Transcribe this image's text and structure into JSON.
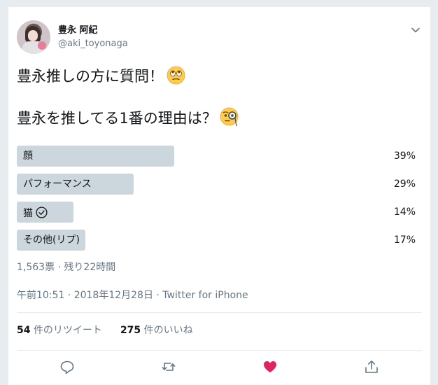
{
  "user": {
    "name": "豊永 阿紀",
    "handle": "@aki_toyonaga"
  },
  "tweet": {
    "line1": "豊永推しの方に質問！",
    "line2": "豊永を推してる1番の理由は？"
  },
  "poll": {
    "options": [
      {
        "label": "顔",
        "percent": 39,
        "percent_label": "39%"
      },
      {
        "label": "パフォーマンス",
        "percent": 29,
        "percent_label": "29%"
      },
      {
        "label": "猫",
        "percent": 14,
        "percent_label": "14%",
        "selected": true
      },
      {
        "label": "その他(リプ)",
        "percent": 17,
        "percent_label": "17%"
      }
    ],
    "summary": "1,563票 · 残り22時間"
  },
  "timestamp": "午前10:51 · 2018年12月28日 · Twitter for iPhone",
  "stats": {
    "retweets_count": "54",
    "retweets_label": "件のリツイート",
    "likes_count": "275",
    "likes_label": "件のいいね"
  },
  "icons": {
    "menu": "chevron-down-icon",
    "reply": "reply-icon",
    "retweet": "retweet-icon",
    "like": "heart-icon",
    "share": "share-icon"
  },
  "colors": {
    "like_active": "#e0245e",
    "icon_gray": "#657786",
    "poll_bar": "#ccd6dd"
  }
}
